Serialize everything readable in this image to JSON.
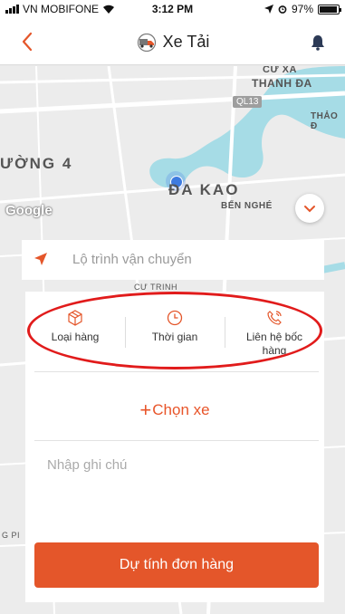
{
  "status_bar": {
    "carrier": "VN MOBIFONE",
    "time": "3:12 PM",
    "battery": "97%",
    "battery_level": 0.97,
    "icons": [
      "signal-icon",
      "wifi-icon",
      "location-arrow-icon",
      "alarm-icon",
      "battery-icon"
    ]
  },
  "nav": {
    "title": "Xe Tải",
    "back_icon": "chevron-left-icon",
    "title_icon": "truck-icon",
    "bell_icon": "bell-icon"
  },
  "map": {
    "labels": [
      "CƯ XÁ",
      "THANH ĐA",
      "QL13",
      "THẢO Đ",
      "ƯỜNG 4",
      "ĐA KAO",
      "BẾN NGHÉ",
      "CƯ TRINH",
      "G PI"
    ],
    "google": "Google",
    "colors": {
      "water": "#a6dce6",
      "land": "#ececec",
      "road": "#ffffff",
      "pin": "#3e7be0"
    }
  },
  "route": {
    "placeholder": "Lộ trình vận chuyển",
    "icon": "location-arrow-icon"
  },
  "tabs": [
    {
      "label": "Loại hàng",
      "icon": "package-icon"
    },
    {
      "label": "Thời gian",
      "icon": "clock-icon"
    },
    {
      "label": "Liên hệ bốc hàng",
      "icon": "phone-icon"
    }
  ],
  "choose_vehicle": {
    "plus": "+",
    "label": "Chọn xe"
  },
  "note": {
    "placeholder": "Nhập ghi chú"
  },
  "estimate_button": {
    "label": "Dự tính đơn hàng"
  },
  "colors": {
    "accent": "#e4562a",
    "highlight": "#e11b1b"
  }
}
